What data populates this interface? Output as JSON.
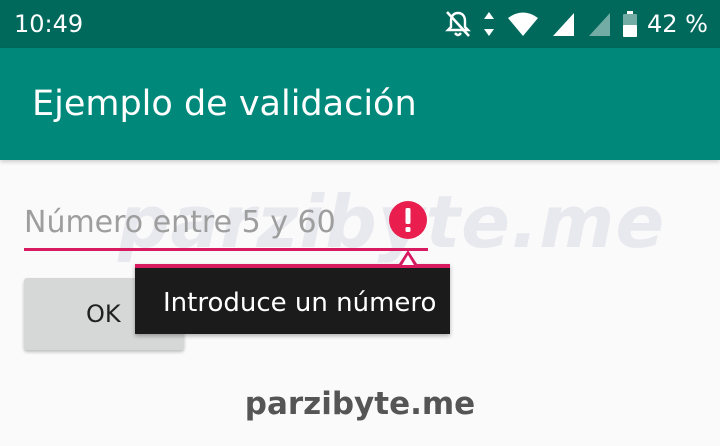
{
  "status_bar": {
    "time": "10:49",
    "battery_percent": "42 %",
    "icons": [
      "notifications-off-icon",
      "data-arrows-icon",
      "wifi-icon",
      "signal-icon",
      "signal-dim-icon",
      "battery-icon"
    ]
  },
  "app_bar": {
    "title": "Ejemplo de validación"
  },
  "form": {
    "number_input": {
      "value": "",
      "placeholder": "Número entre 5 y 60"
    },
    "error_tooltip": "Introduce un número",
    "ok_button": "OK"
  },
  "watermark": {
    "text": "parzibyte.me",
    "footer": "parzibyte.me"
  },
  "colors": {
    "status_bar": "#00695c",
    "app_bar": "#00897b",
    "accent_error": "#d81b60",
    "error_icon": "#e91e4f",
    "tooltip_bg": "#1b1b1b",
    "button_bg": "#d6d7d7"
  }
}
